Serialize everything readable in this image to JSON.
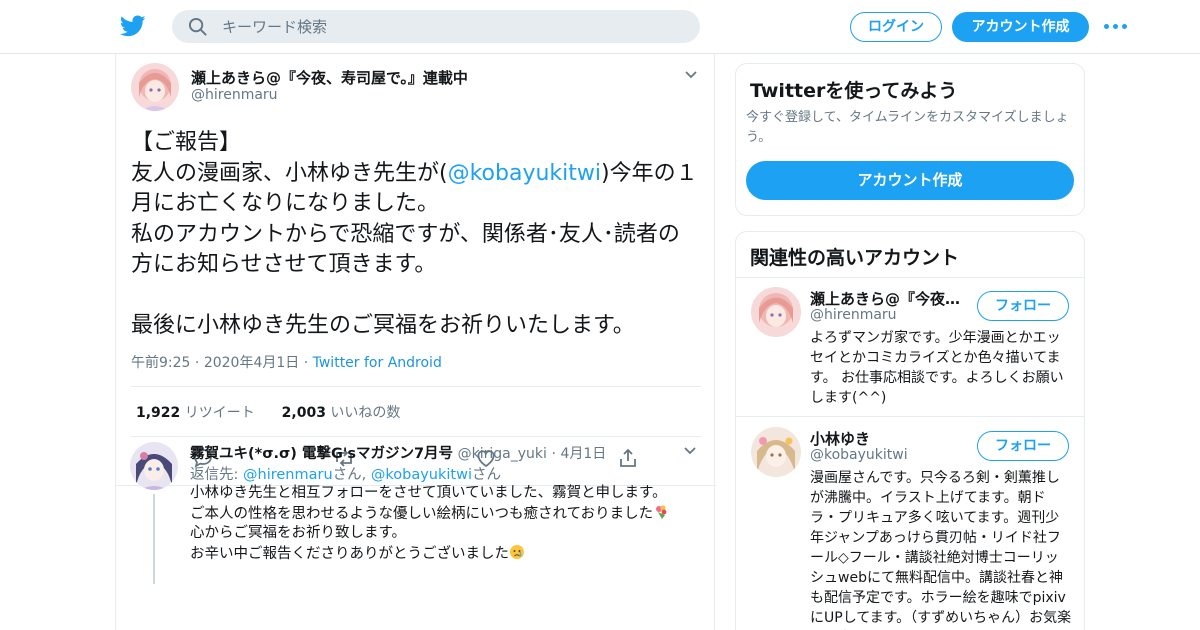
{
  "colors": {
    "accent": "#1da1f2",
    "text": "#14171a",
    "muted": "#657786",
    "border": "#e6ecf0"
  },
  "header": {
    "logo_icon": "twitter-bird-icon",
    "search_placeholder": "キーワード検索",
    "login_label": "ログイン",
    "signup_label": "アカウント作成",
    "more_icon": "more-dots-icon"
  },
  "tweet": {
    "author_name": "瀬上あきら@『今夜、寿司屋で。』連載中",
    "author_handle": "@hirenmaru",
    "text_part1": "【ご報告】\n友人の漫画家、小林ゆき先生が(",
    "mention": "@kobayukitwi",
    "text_part2": ")今年の１月にお亡くなりになりました。\n私のアカウントからで恐縮ですが、関係者･友人･読者の方にお知らせさせて頂きます。\n\n最後に小林ゆき先生のご冥福をお祈りいたします。",
    "time": "午前9:25",
    "date": "2020年4月1日",
    "source": "Twitter for Android",
    "retweet_count": "1,922",
    "retweet_label": "リツイート",
    "like_count": "2,003",
    "like_label": "いいねの数"
  },
  "reply": {
    "author_name": "霧賀ユキ(*σ.σ) 電撃G'sマガジン7月号",
    "author_handle": "@kiriga_yuki",
    "date": "4月1日",
    "reply_to_label": "返信先:",
    "reply_to_user1": "@hirenmaru",
    "reply_to_user2": "@kobayukitwi",
    "san": "さん",
    "sep": ",",
    "text_part1": "小林ゆき先生と相互フォローをさせて頂いていました、霧賀と申します。\nご本人の性格を思わせるような優しい絵柄にいつも癒されておりました",
    "text_part2": "\n心からご冥福をお祈り致します。\nお辛い中ご報告くださりありがとうございました"
  },
  "sidebar": {
    "signup_card": {
      "title": "Twitterを使ってみよう",
      "subtitle": "今すぐ登録して、タイムラインをカスタマイズしましょう。",
      "button": "アカウント作成"
    },
    "related": {
      "title": "関連性の高いアカウント",
      "accounts": [
        {
          "name": "瀬上あきら@『今夜…",
          "handle": "@hirenmaru",
          "follow_label": "フォロー",
          "bio": "よろずマンガ家です。少年漫画とかエッセイとかコミカライズとか色々描いてます。 お仕事応相談です。よろしくお願いします(^^)"
        },
        {
          "name": "小林ゆき",
          "handle": "@kobayukitwi",
          "follow_label": "フォロー",
          "bio": "漫画屋さんです。只今るろ剣・剣薫推しが沸騰中。イラスト上げてます。朝ドラ・プリキュア多く呟いてます。週刊少年ジャンプあっけら貫刃帖・リイド社フール◇フール・講談社絶対博士コーリッシュwebにて無料配信中。講談社春と神も配信予定です。ホラー絵を趣味でpixivにUPしてます。（すずめいちゃん）お気楽にお声かけて下さい"
        }
      ]
    }
  }
}
